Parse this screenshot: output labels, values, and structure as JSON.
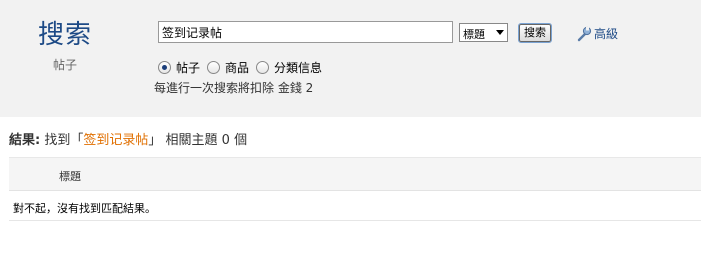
{
  "brand": {
    "title": "搜索",
    "subtitle": "帖子"
  },
  "search": {
    "keyword": "签到记录帖",
    "type_selected": "標題",
    "button_label": "搜索",
    "advanced_label": "高級"
  },
  "scopes": [
    {
      "label": "帖子",
      "checked": true
    },
    {
      "label": "商品",
      "checked": false
    },
    {
      "label": "分類信息",
      "checked": false
    }
  ],
  "cost_note": "每進行一次搜索將扣除 金錢 2",
  "result": {
    "label": "結果:",
    "prefix": "找到",
    "open_quote": "「",
    "keyword": "签到记录帖",
    "close_quote": "」",
    "suffix": "相關主題 0 個"
  },
  "table": {
    "column_title": "標題",
    "empty_message": "對不起，沒有找到匹配結果。"
  },
  "colors": {
    "brand": "#1d4a86",
    "keyword_highlight": "#e06f00",
    "panel_bg": "#f2f2f2"
  }
}
